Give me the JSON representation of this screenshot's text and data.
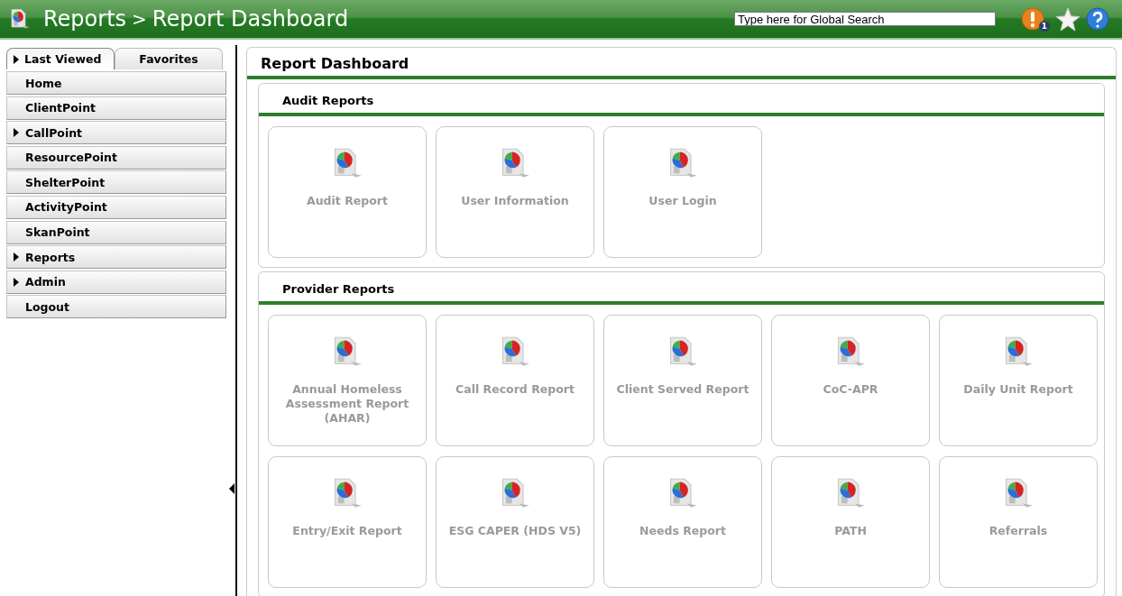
{
  "header": {
    "breadcrumb": [
      "Reports",
      "Report Dashboard"
    ],
    "separator": ">",
    "search": {
      "placeholder": "Type here for Global Search"
    },
    "alert_count": "1"
  },
  "sidebar": {
    "tabs": [
      {
        "label": "Last Viewed",
        "selected": true
      },
      {
        "label": "Favorites",
        "selected": false
      }
    ],
    "items": [
      {
        "label": "Home",
        "expandable": false
      },
      {
        "label": "ClientPoint",
        "expandable": false
      },
      {
        "label": "CallPoint",
        "expandable": true
      },
      {
        "label": "ResourcePoint",
        "expandable": false
      },
      {
        "label": "ShelterPoint",
        "expandable": false
      },
      {
        "label": "ActivityPoint",
        "expandable": false
      },
      {
        "label": "SkanPoint",
        "expandable": false
      },
      {
        "label": "Reports",
        "expandable": true
      },
      {
        "label": "Admin",
        "expandable": true
      },
      {
        "label": "Logout",
        "expandable": false
      }
    ]
  },
  "main": {
    "title": "Report Dashboard",
    "sections": [
      {
        "title": "Audit Reports",
        "tiles": [
          "Audit Report",
          "User Information",
          "User Login"
        ]
      },
      {
        "title": "Provider Reports",
        "tiles": [
          "Annual Homeless Assessment Report (AHAR)",
          "Call Record Report",
          "Client Served Report",
          "CoC-APR",
          "Daily Unit Report",
          "Entry/Exit Report",
          "ESG CAPER (HDS V5)",
          "Needs Report",
          "PATH",
          "Referrals"
        ]
      }
    ]
  }
}
